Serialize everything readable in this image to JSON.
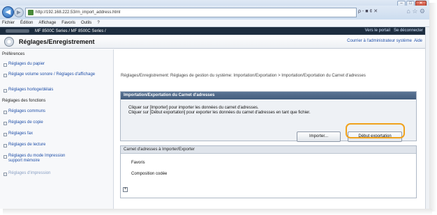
{
  "browser": {
    "url": "http://192.168.222.53/rn_import_address.html",
    "addr_tools": "ρ - ■ ¢ ✕",
    "nav_icons": "⌂ ☆ ⚙",
    "menu": [
      "Fichier",
      "Édition",
      "Affichage",
      "Favoris",
      "Outils",
      "?"
    ]
  },
  "device": {
    "model": "MF 8500C Series / MF 8500C Series /",
    "portal_link": "Vers le portail",
    "logout_link": "Se déconnecter"
  },
  "header": {
    "title": "Réglages/Enregistrement",
    "admin_link": "Courrier à l'administrateur système",
    "help_link": "Aide"
  },
  "sidebar": {
    "preferences_heading": "Préférences",
    "pref_items": [
      "Réglages du papier",
      "Réglage volume sonore / Réglages d'affichage",
      "Réglages horloge/délais"
    ],
    "functions_heading": "Réglages des fonctions",
    "func_items": [
      "Réglages communs",
      "Réglages de copie",
      "Réglages fax",
      "Réglages de lecture",
      "Réglages du mode Impression support mémoire",
      "Réglages d'impression"
    ]
  },
  "main": {
    "breadcrumb": "Réglages/Enregistrement: Réglages de gestion du système: Importation/Exportation > Importation/Exportation du Carnet d'adresses",
    "panel_title": "Importation/Exportation du Carnet d'adresses",
    "desc_line1": "Cliquer sur [Importer] pour importer les données du carnet d'adresses.",
    "desc_line2": "Cliquer sur [Début exportation] pour exporter les données du carnet d'adresses en tant que fichier.",
    "import_button": "Importer...",
    "export_button": "Début exportation",
    "list_title": "Carnet d'adresses à Importer/Exporter",
    "list_items": [
      "Favoris",
      "Composition codée"
    ],
    "expand_glyph": "+"
  }
}
